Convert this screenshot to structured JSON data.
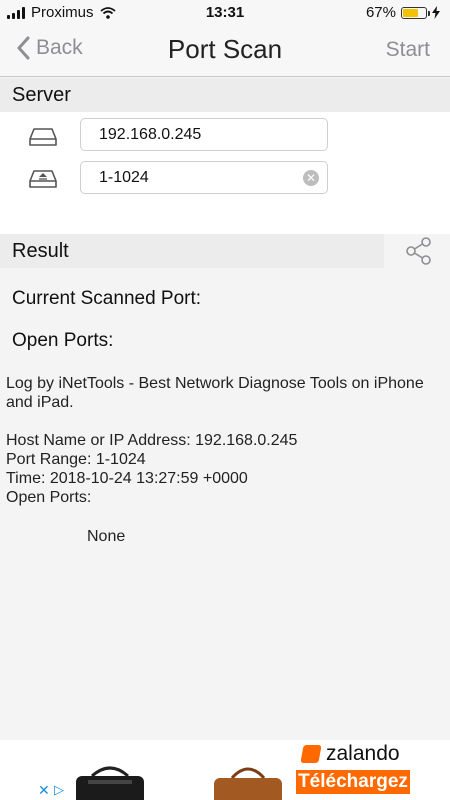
{
  "status_bar": {
    "carrier": "Proximus",
    "time": "13:31",
    "battery": "67%",
    "battery_level": 0.67
  },
  "nav": {
    "back_label": "Back",
    "title": "Port Scan",
    "start_label": "Start"
  },
  "server": {
    "header": "Server",
    "host_value": "192.168.0.245",
    "port_range_value": "1-1024"
  },
  "result": {
    "header": "Result",
    "current_port_label": "Current Scanned Port:",
    "open_ports_label": "Open Ports:",
    "log": "Log by iNetTools - Best Network Diagnose Tools on iPhone and iPad.\n\nHost Name or IP Address: 192.168.0.245\nPort Range: 1-1024\nTime: 2018-10-24 13:27:59 +0000\nOpen Ports:",
    "none_text": "None"
  },
  "ad": {
    "brand": "zalando",
    "cta_label": "Téléchargez",
    "brand_color": "#ff6900"
  },
  "icons": {
    "back": "chevron-left-icon",
    "host": "drive-icon",
    "port": "eject-drive-icon",
    "share": "share-icon",
    "clear": "clear-icon"
  }
}
